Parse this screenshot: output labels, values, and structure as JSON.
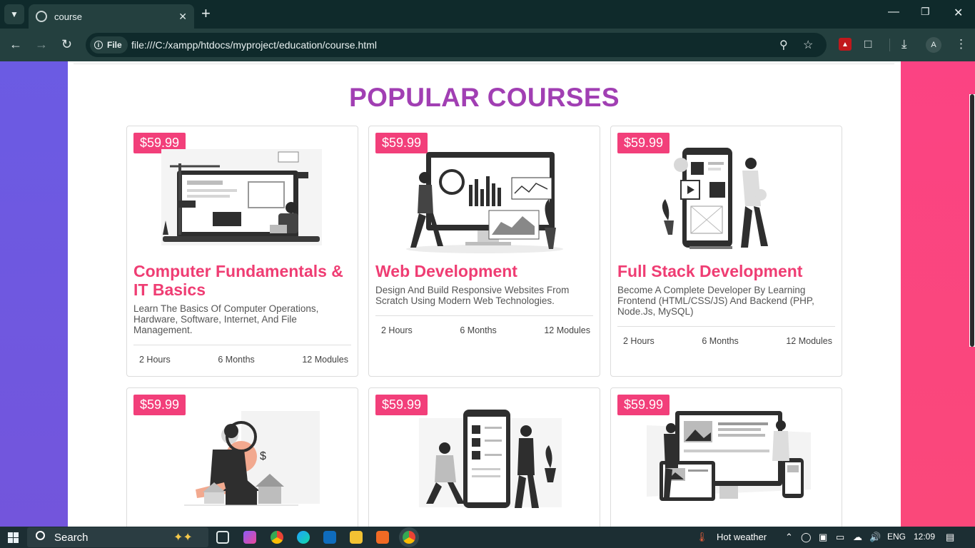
{
  "browser": {
    "tab_title": "course",
    "url": "file:///C:/xampp/htdocs/myproject/education/course.html",
    "scheme_chip": "File",
    "avatar_letter": "A"
  },
  "page": {
    "heading": "POPULAR COURSES",
    "colors": {
      "heading": "#a13fb3",
      "title": "#ef3d73",
      "price_bg": "#f23f7a",
      "left_band": "#6e57e0",
      "right_band": "#ff4b7d"
    },
    "courses": [
      {
        "price": "$59.99",
        "title": "Computer Fundamentals & IT Basics",
        "desc": "Learn The Basics Of Computer Operations, Hardware, Software, Internet, And File Management.",
        "hours": "2 Hours",
        "months": "6 Months",
        "modules": "12 Modules",
        "illustration": "laptop-coding-illustration"
      },
      {
        "price": "$59.99",
        "title": "Web Development",
        "desc": "Design And Build Responsive Websites From Scratch Using Modern Web Technologies.",
        "hours": "2 Hours",
        "months": "6 Months",
        "modules": "12 Modules",
        "illustration": "analytics-monitor-illustration"
      },
      {
        "price": "$59.99",
        "title": "Full Stack Development",
        "desc": "Become A Complete Developer By Learning Frontend (HTML/CSS/JS) And Backend (PHP, Node.Js, MySQL)",
        "hours": "2 Hours",
        "months": "6 Months",
        "modules": "12 Modules",
        "illustration": "mobile-app-illustration"
      },
      {
        "price": "$59.99",
        "illustration": "real-estate-search-illustration"
      },
      {
        "price": "$59.99",
        "illustration": "mobile-ui-team-illustration"
      },
      {
        "price": "$59.99",
        "illustration": "multi-device-design-illustration"
      }
    ]
  },
  "taskbar": {
    "search_label": "Search",
    "weather": "Hot weather",
    "language": "ENG",
    "time": "12:09"
  }
}
